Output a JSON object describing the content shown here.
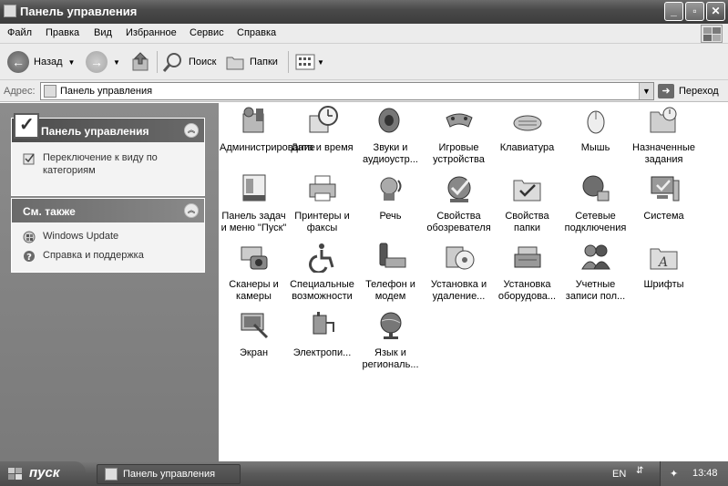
{
  "window": {
    "title": "Панель управления",
    "min_glyph": "_",
    "max_glyph": "▫",
    "close_glyph": "✕"
  },
  "menu": [
    "Файл",
    "Правка",
    "Вид",
    "Избранное",
    "Сервис",
    "Справка"
  ],
  "toolbar": {
    "back_label": "Назад",
    "search_label": "Поиск",
    "folders_label": "Папки"
  },
  "address": {
    "label": "Адрес:",
    "value": "Панель управления",
    "go_label": "Переход"
  },
  "sidebar": {
    "panel1": {
      "title": "Панель управления",
      "task": "Переключение к виду по категориям"
    },
    "panel2": {
      "title": "См. также",
      "links": [
        "Windows Update",
        "Справка и поддержка"
      ]
    }
  },
  "items": [
    {
      "label": "Администрирование",
      "icon": "admin-tools-icon"
    },
    {
      "label": "Дата и время",
      "icon": "date-time-icon"
    },
    {
      "label": "Звуки и аудиоустр...",
      "icon": "sounds-icon"
    },
    {
      "label": "Игровые устройства",
      "icon": "game-controller-icon"
    },
    {
      "label": "Клавиатура",
      "icon": "keyboard-icon"
    },
    {
      "label": "Мышь",
      "icon": "mouse-icon"
    },
    {
      "label": "Назначенные задания",
      "icon": "scheduled-tasks-icon"
    },
    {
      "label": "Панель задач и меню \"Пуск\"",
      "icon": "taskbar-icon"
    },
    {
      "label": "Принтеры и факсы",
      "icon": "printers-icon"
    },
    {
      "label": "Речь",
      "icon": "speech-icon"
    },
    {
      "label": "Свойства обозревателя",
      "icon": "internet-options-icon"
    },
    {
      "label": "Свойства папки",
      "icon": "folder-options-icon"
    },
    {
      "label": "Сетевые подключения",
      "icon": "network-icon"
    },
    {
      "label": "Система",
      "icon": "system-icon"
    },
    {
      "label": "Сканеры и камеры",
      "icon": "scanners-icon"
    },
    {
      "label": "Специальные возможности",
      "icon": "accessibility-icon"
    },
    {
      "label": "Телефон и модем",
      "icon": "phone-modem-icon"
    },
    {
      "label": "Установка и удаление...",
      "icon": "add-remove-icon"
    },
    {
      "label": "Установка оборудова...",
      "icon": "add-hardware-icon"
    },
    {
      "label": "Учетные записи пол...",
      "icon": "user-accounts-icon"
    },
    {
      "label": "Шрифты",
      "icon": "fonts-icon"
    },
    {
      "label": "Экран",
      "icon": "display-icon"
    },
    {
      "label": "Электропи...",
      "icon": "power-icon"
    },
    {
      "label": "Язык и региональ...",
      "icon": "regional-icon"
    }
  ],
  "taskbar": {
    "start_label": "пуск",
    "task_label": "Панель управления",
    "lang": "EN",
    "clock": "13:48"
  }
}
